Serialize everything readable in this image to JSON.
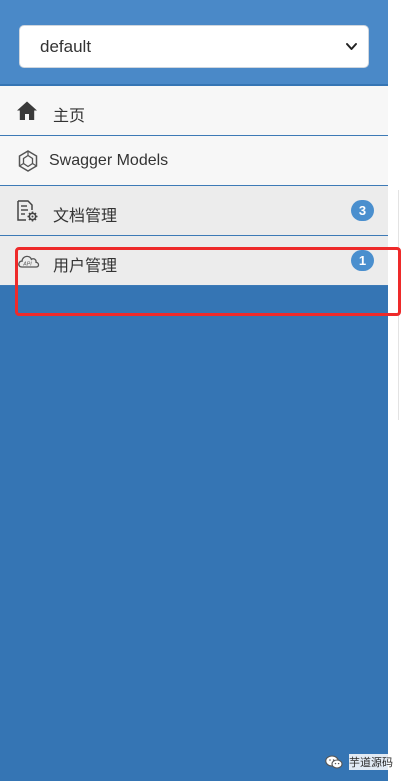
{
  "group_select": {
    "value": "default",
    "caret_icon": "chevron-down-icon"
  },
  "menu": {
    "items": [
      {
        "label": "主页",
        "icon": "home-icon"
      },
      {
        "label": "Swagger Models",
        "icon": "models-icon"
      },
      {
        "label": "文档管理",
        "icon": "document-settings-icon",
        "badge": "3"
      },
      {
        "label": "用户管理",
        "icon": "api-cloud-icon",
        "badge": "1"
      }
    ]
  },
  "watermark": {
    "text": "芋道源码",
    "icon": "wechat-icon"
  },
  "colors": {
    "sidebar_bg": "#3575b4",
    "header_bg": "#4a89c8",
    "badge_bg": "#4a8fce",
    "highlight_border": "#ee2a2a"
  }
}
